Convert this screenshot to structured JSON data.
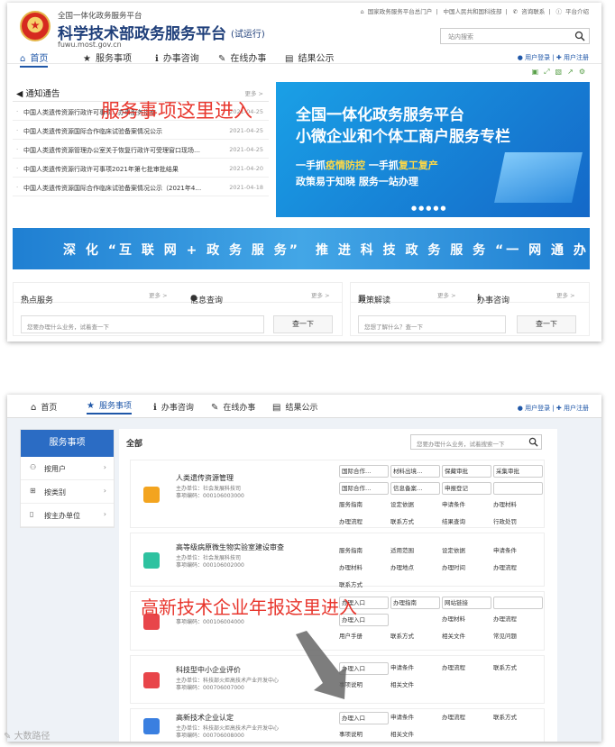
{
  "header": {
    "small_title": "全国一体化政务服务平台",
    "title": "科学技术部政务服务平台",
    "trial": "(试运行)",
    "url": "fuwu.most.gov.cn",
    "top_links": [
      "国家政务服务平台总门户",
      "中国人民共和国科技部",
      "咨询联系",
      "平台介绍"
    ],
    "search_placeholder": "站内搜索",
    "user_login": "用户登录",
    "user_register": "用户注册"
  },
  "nav": [
    {
      "label": "首页",
      "icon": "home-icon"
    },
    {
      "label": "服务事项",
      "icon": "star-icon"
    },
    {
      "label": "办事咨询",
      "icon": "info-icon"
    },
    {
      "label": "在线办事",
      "icon": "pen-icon"
    },
    {
      "label": "结果公示",
      "icon": "document-icon"
    }
  ],
  "notice": {
    "title": "通知通告",
    "more": "更多 >",
    "rows": [
      {
        "text": "中国人类遗传资源行政许可事项…办事服务指南",
        "date": "2021-04-25"
      },
      {
        "text": "中国人类遗传资源国际合作临床试验备案情况公示",
        "date": "2021-04-25"
      },
      {
        "text": "中国人类遗传资源管理办公室关于恢复行政许可受理窗口现场…",
        "date": "2021-04-25"
      },
      {
        "text": "中国人类遗传资源行政许可事项2021年第七批审批结果",
        "date": "2021-04-20"
      },
      {
        "text": "中国人类遗传资源国际合作临床试验备案情况公示（2021年4…",
        "date": "2021-04-18"
      }
    ]
  },
  "annotation1": "服务事项这里进入",
  "banner": {
    "line1": "全国一体化政务服务平台",
    "line2": "小微企业和个体工商户服务专栏",
    "line3a": "一手抓",
    "line3b": "疫情防控",
    "line3c": " 一手抓",
    "line3d": "复工复产",
    "line4": "政策易于知晓 服务一站办理"
  },
  "strip": {
    "left": "深 化 “互 联 网 + 政 务 服 务”",
    "right": "推 进 科 技 政 务 服 务 “一 网 通 办”"
  },
  "panels": {
    "hot_service": "热点服务",
    "info_query": "信息查询",
    "policy": "政策解读",
    "consult": "办事咨询",
    "more": "更多 >",
    "left_placeholder": "您要办理什么业务，试着查一下",
    "left_button": "查一下",
    "right_placeholder": "您想了解什么？查一下",
    "right_button": "查一下"
  },
  "side": {
    "title": "服务事项",
    "items": [
      "按用户",
      "按类别",
      "按主办单位"
    ]
  },
  "main": {
    "all": "全部",
    "search_placeholder": "您要办理什么业务，试着搜索一下",
    "items": [
      {
        "name": "人类遗传资源管理",
        "unit": "主办单位：社会发展科技司",
        "code": "事项编码：000106003000",
        "color": "#f3a41f",
        "actions": [
          "国际合作…",
          "材料出境…",
          "保藏审批",
          "采集审批",
          "国际合作…",
          "信息备案…",
          "申报登记",
          "",
          "服务指南",
          "设定依据",
          "申请条件",
          "办理材料",
          "办理流程",
          "联系方式",
          "结果查询",
          "行政处罚",
          "常见问题",
          "我要评价"
        ]
      },
      {
        "name": "高等级病原微生物实验室建设审查",
        "unit": "主办单位：社会发展科技司",
        "code": "事项编码：000106002000",
        "color": "#2ec2a0",
        "actions": [
          "服务指南",
          "适用范围",
          "设定依据",
          "申请条件",
          "办理材料",
          "办理地点",
          "办理时间",
          "办理流程",
          "联系方式"
        ]
      },
      {
        "name": "",
        "unit": "",
        "code": "事项编码：000106004000",
        "color": "#e8454a",
        "actions": [
          "办理入口",
          "办理指南",
          "网站链接",
          "",
          "办理入口",
          "",
          "办理材料",
          "办理流程",
          "用户手册",
          "联系方式",
          "相关文件",
          "常见问题"
        ]
      },
      {
        "name": "科技型中小企业评价",
        "unit": "主办单位：科技部火炬高技术产业开发中心",
        "code": "事项编码：000706007000",
        "color": "#e8454a",
        "actions": [
          "办理入口",
          "申请条件",
          "办理流程",
          "联系方式",
          "事项说明",
          "相关文件"
        ]
      },
      {
        "name": "高新技术企业认定",
        "unit": "主办单位：科技部火炬高技术产业开发中心",
        "code": "事项编码：000706008000",
        "color": "#3a7fe0",
        "actions": [
          "办理入口",
          "申请条件",
          "办理流程",
          "联系方式",
          "事项说明",
          "相关文件"
        ]
      }
    ]
  },
  "annotation2": "高新技术企业年报这里进入",
  "watermark": "大数路径"
}
